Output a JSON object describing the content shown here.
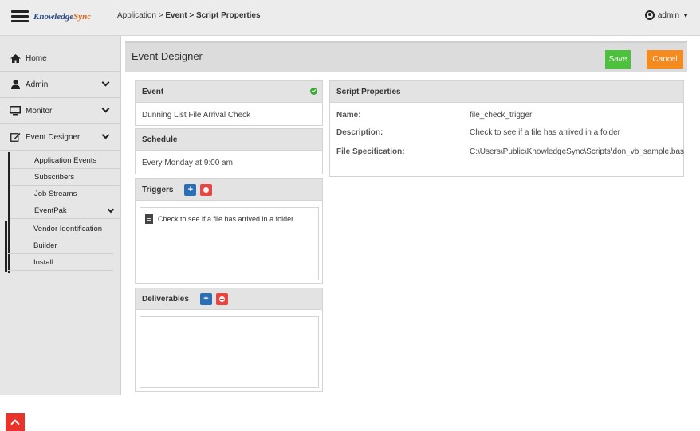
{
  "app": {
    "logo_text": "Knowledge",
    "logo_accent": "Sync",
    "brand_color": "#2b4a8c",
    "accent_color": "#e06a1a"
  },
  "breadcrumb": {
    "root": "Application",
    "sep1": ">",
    "mid": "Event",
    "sep2": ">",
    "current": "Script Properties"
  },
  "user": {
    "name": "admin",
    "icon": "user-circle-icon"
  },
  "sidebar": {
    "items": [
      {
        "label": "Home",
        "icon": "home-icon"
      },
      {
        "label": "Admin",
        "icon": "user-icon"
      },
      {
        "label": "Monitor",
        "icon": "monitor-icon"
      },
      {
        "label": "Event Designer",
        "icon": "edit-icon"
      }
    ],
    "event_designer_children": [
      {
        "label": "Application Events"
      },
      {
        "label": "Subscribers"
      },
      {
        "label": "Job Streams"
      },
      {
        "label": "EventPak"
      }
    ],
    "eventpak_children": [
      {
        "label": "Vendor Identification"
      },
      {
        "label": "Builder"
      },
      {
        "label": "Install"
      }
    ]
  },
  "header": {
    "title": "Event Designer",
    "save_label": "Save",
    "cancel_label": "Cancel",
    "save_color": "#4cc13b",
    "cancel_color": "#f58a1f"
  },
  "event_panel": {
    "title": "Event",
    "value": "Dunning List File Arrival Check",
    "status": "valid"
  },
  "schedule_panel": {
    "title": "Schedule",
    "value": "Every Monday at 9:00 am"
  },
  "triggers_panel": {
    "title": "Triggers",
    "items": [
      {
        "label": "Check to see if a file has arrived in a folder"
      }
    ]
  },
  "deliverables_panel": {
    "title": "Deliverables",
    "items": []
  },
  "script_properties": {
    "title": "Script Properties",
    "rows": [
      {
        "label": "Name:",
        "value": "file_check_trigger"
      },
      {
        "label": "Description:",
        "value": "Check to see if a file has arrived in a folder"
      },
      {
        "label": "File Specification:",
        "value": "C:\\Users\\Public\\KnowledgeSync\\Scripts\\don_vb_sample.bas"
      }
    ]
  }
}
